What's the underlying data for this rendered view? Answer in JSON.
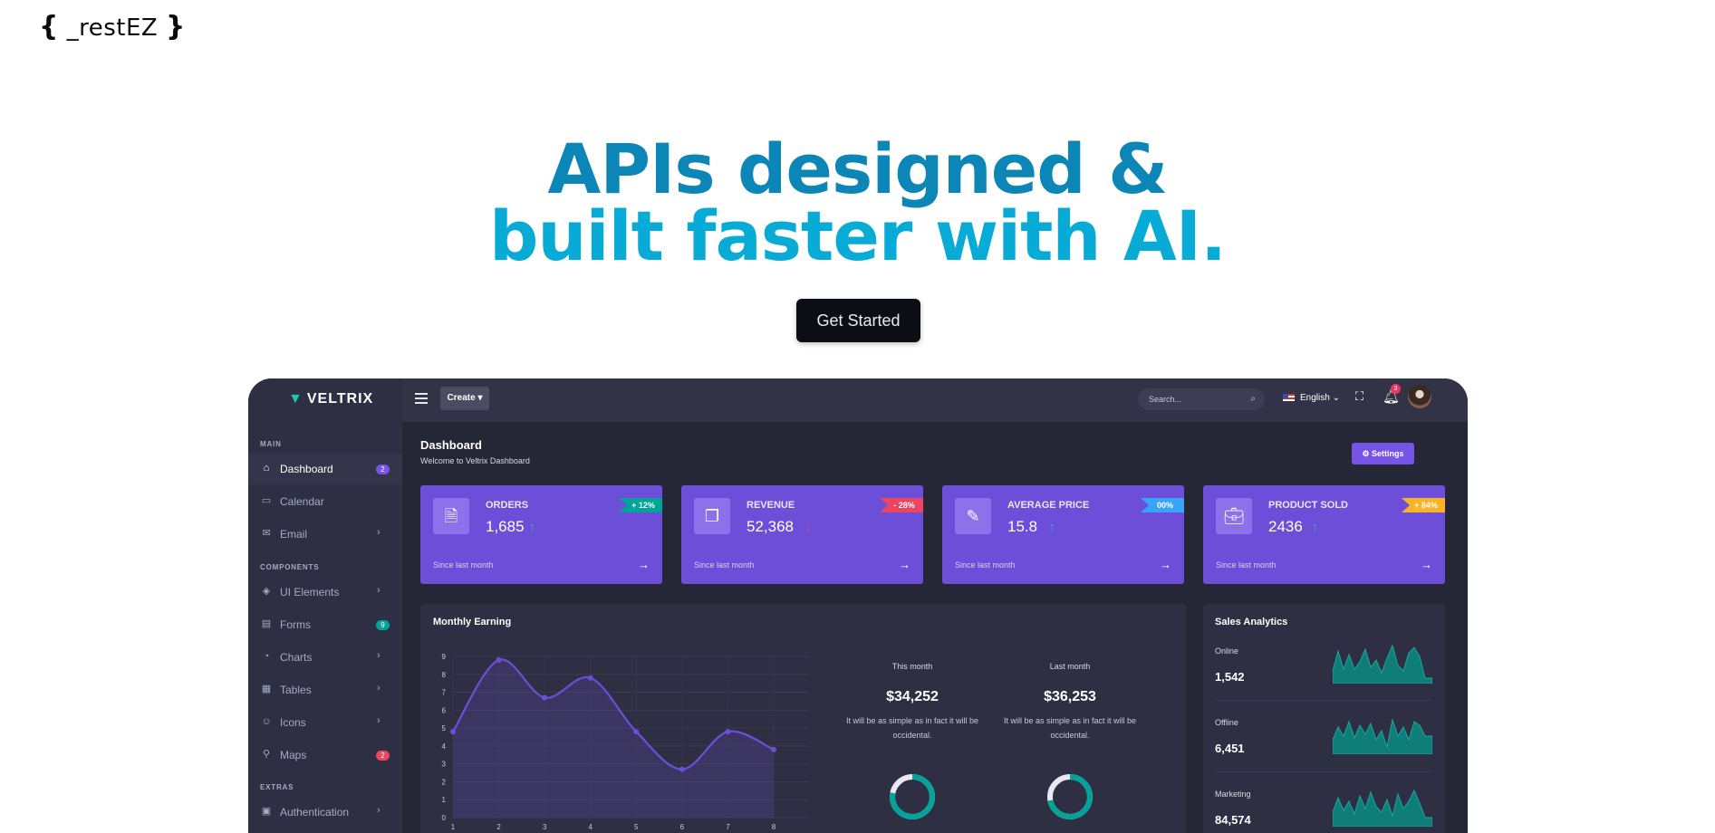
{
  "site": {
    "logo_open": "{",
    "logo_name": "_restEZ",
    "logo_close": "}"
  },
  "hero": {
    "line1": "APIs designed &",
    "line2": "built faster with AI.",
    "cta": "Get Started"
  },
  "dashboard": {
    "brand": "VELTRIX",
    "create": "Create ▾",
    "search_placeholder": "Search...",
    "language": "English ⌄",
    "notif_count": "3",
    "page_title": "Dashboard",
    "page_subtitle": "Welcome to Veltrix Dashboard",
    "settings": "⚙  Settings",
    "sections": {
      "main": "MAIN",
      "components": "COMPONENTS",
      "extras": "EXTRAS"
    },
    "nav": [
      {
        "label": "Dashboard",
        "icon": "home-icon",
        "badge": "2",
        "badge_color": "#7554e7"
      },
      {
        "label": "Calendar",
        "icon": "calendar-icon"
      },
      {
        "label": "Email",
        "icon": "mail-icon",
        "chevron": true
      },
      {
        "label": "UI Elements",
        "icon": "cube-icon",
        "chevron": true
      },
      {
        "label": "Forms",
        "icon": "form-icon",
        "badge": "9",
        "badge_color": "#02a499"
      },
      {
        "label": "Charts",
        "icon": "pie-chart-icon",
        "chevron": true
      },
      {
        "label": "Tables",
        "icon": "grid-icon",
        "chevron": true
      },
      {
        "label": "Icons",
        "icon": "smile-icon",
        "chevron": true
      },
      {
        "label": "Maps",
        "icon": "map-pin-icon",
        "badge": "2",
        "badge_color": "#ec4561"
      },
      {
        "label": "Authentication",
        "icon": "archive-icon",
        "chevron": true
      }
    ],
    "cards": [
      {
        "title": "ORDERS",
        "value": "1,685",
        "badge": "+ 12%",
        "badge_color": "#02a499",
        "trend": "up",
        "since": "Since last month",
        "icon": "orders-icon"
      },
      {
        "title": "REVENUE",
        "value": "52,368",
        "badge": "- 28%",
        "badge_color": "#ec4561",
        "trend": "down",
        "since": "Since last month",
        "icon": "revenue-icon"
      },
      {
        "title": "AVERAGE PRICE",
        "value": "15.8",
        "badge": "00%",
        "badge_color": "#38a4f8",
        "trend": "up",
        "since": "Since last month",
        "icon": "pencil-icon"
      },
      {
        "title": "PRODUCT SOLD",
        "value": "2436",
        "badge": "+ 84%",
        "badge_color": "#f8b425",
        "trend": "up",
        "since": "Since last month",
        "icon": "briefcase-icon"
      }
    ],
    "monthly": {
      "title": "Monthly Earning",
      "this_month_label": "This month",
      "this_month_value": "$34,252",
      "last_month_label": "Last month",
      "last_month_value": "$36,253",
      "desc": "It will be as simple as in fact it will be occidental.",
      "this_month_donut": 0.78,
      "last_month_donut": 0.72
    },
    "sales": {
      "title": "Sales Analytics",
      "rows": [
        {
          "label": "Online",
          "value": "1,542"
        },
        {
          "label": "Offline",
          "value": "6,451"
        },
        {
          "label": "Marketing",
          "value": "84,574"
        }
      ]
    }
  },
  "chart_data": {
    "type": "area",
    "x": [
      1,
      2,
      3,
      4,
      5,
      6,
      7,
      8
    ],
    "series": [
      {
        "values": [
          4.8,
          8.8,
          6.7,
          7.8,
          4.8,
          2.7,
          4.8,
          3.8
        ]
      }
    ],
    "xlim": [
      1,
      8
    ],
    "ylim": [
      0,
      9
    ],
    "yticks": [
      0,
      1,
      2,
      3,
      4,
      5,
      6,
      7,
      8,
      9
    ],
    "grid": true,
    "color": "#6c4ed8"
  }
}
